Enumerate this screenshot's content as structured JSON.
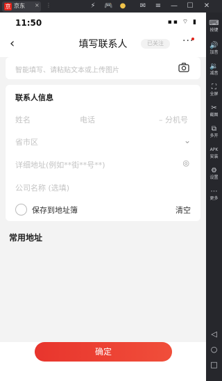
{
  "emulator": {
    "tab_label": "京东",
    "tab_logo": "京",
    "tab_close": "×",
    "titlebar_icons": [
      "app-icon",
      "gamepad-icon",
      "avatar-icon",
      "mail-icon",
      "menu-icon",
      "minimize-icon",
      "restore-icon",
      "close-icon"
    ],
    "titlebar_glyphs": [
      "⚡",
      "🎮",
      "●",
      "✉",
      "≡",
      "—",
      "☐",
      "✕"
    ],
    "sidebar": [
      {
        "icon": "keyboard-icon",
        "glyph": "⌨",
        "label": "按键"
      },
      {
        "icon": "volume-up-icon",
        "glyph": "🔊",
        "label": "加音"
      },
      {
        "icon": "volume-down-icon",
        "glyph": "🔉",
        "label": "减音"
      },
      {
        "icon": "fullscreen-icon",
        "glyph": "⛶",
        "label": "全屏"
      },
      {
        "icon": "screenshot-icon",
        "glyph": "✂",
        "label": "截图"
      },
      {
        "icon": "multi-instance-icon",
        "glyph": "⧉",
        "label": "多开"
      },
      {
        "icon": "install-apk-icon",
        "glyph": "APK",
        "label": "安装"
      },
      {
        "icon": "settings-icon",
        "glyph": "⚙",
        "label": "设置"
      },
      {
        "icon": "more-icon",
        "glyph": "⋯",
        "label": "更多"
      }
    ],
    "nav": {
      "back": "◁",
      "home": "○",
      "recent": "□"
    }
  },
  "status": {
    "time": "11:50",
    "icons": "▪▪ ⌔ ▮"
  },
  "nav": {
    "back": "‹",
    "title": "填写联系人",
    "follow": "已关注",
    "more": "···"
  },
  "smart_fill": {
    "placeholder": "智能填写、请粘贴文本或上传图片"
  },
  "contact": {
    "section_title": "联系人信息",
    "name_placeholder": "姓名",
    "phone_placeholder": "电话",
    "ext_placeholder": "– 分机号",
    "region_placeholder": "省市区",
    "address_placeholder": "详细地址(例如**街**号**)",
    "company_placeholder": "公司名称 (选填)",
    "save_label": "保存到地址簿",
    "clear_label": "清空"
  },
  "common_address_title": "常用地址",
  "confirm_label": "确定",
  "colors": {
    "accent": "#e8352d",
    "background": "#f3f3f3"
  }
}
